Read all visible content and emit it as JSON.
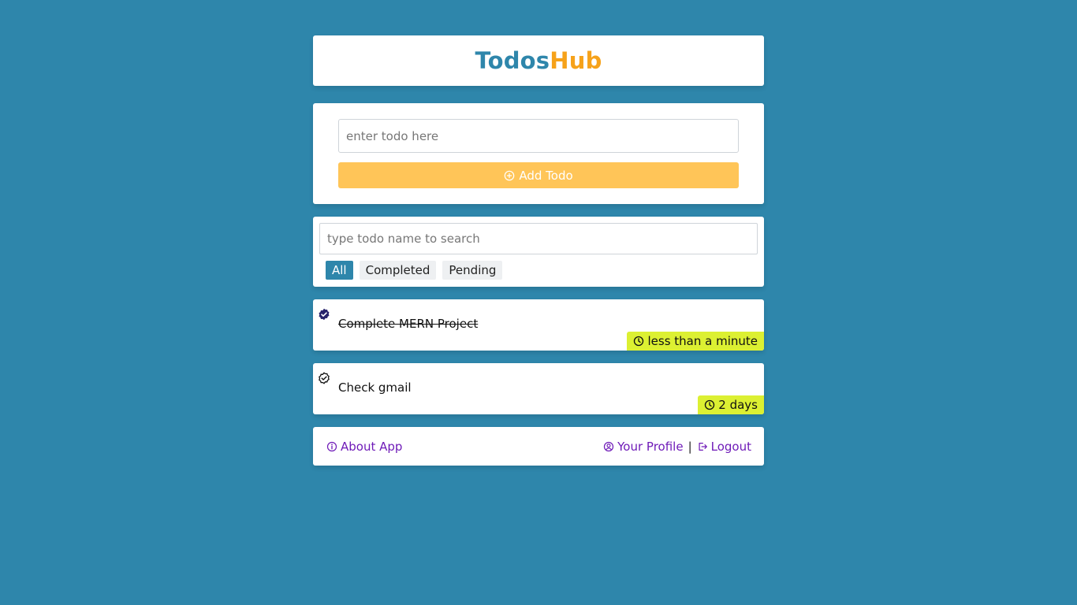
{
  "header": {
    "logo_part1": "Todos",
    "logo_part2": "Hub"
  },
  "add_todo": {
    "placeholder": "enter todo here",
    "button_label": "Add Todo"
  },
  "search": {
    "placeholder": "type todo name to search",
    "filters": [
      {
        "label": "All",
        "active": true
      },
      {
        "label": "Completed",
        "active": false
      },
      {
        "label": "Pending",
        "active": false
      }
    ]
  },
  "todos": [
    {
      "text": "Complete MERN Project",
      "completed": true,
      "time": "less than a minute"
    },
    {
      "text": "Check gmail",
      "completed": false,
      "time": "2 days"
    }
  ],
  "footer": {
    "about": "About App",
    "profile": "Your Profile",
    "separator": "|",
    "logout": "Logout"
  },
  "colors": {
    "background": "#2e86ab",
    "brand_primary": "#2e86ab",
    "brand_accent": "#f6a21a",
    "add_button": "#ffc558",
    "time_badge": "#dcf032",
    "link": "#6f1bb8"
  },
  "icons": {
    "add_button": "plus-circle-icon",
    "completed_todo": "check-badge-filled-icon",
    "pending_todo": "check-badge-outline-icon",
    "time": "clock-icon",
    "about": "info-icon",
    "profile": "user-circle-icon",
    "logout": "logout-icon"
  }
}
